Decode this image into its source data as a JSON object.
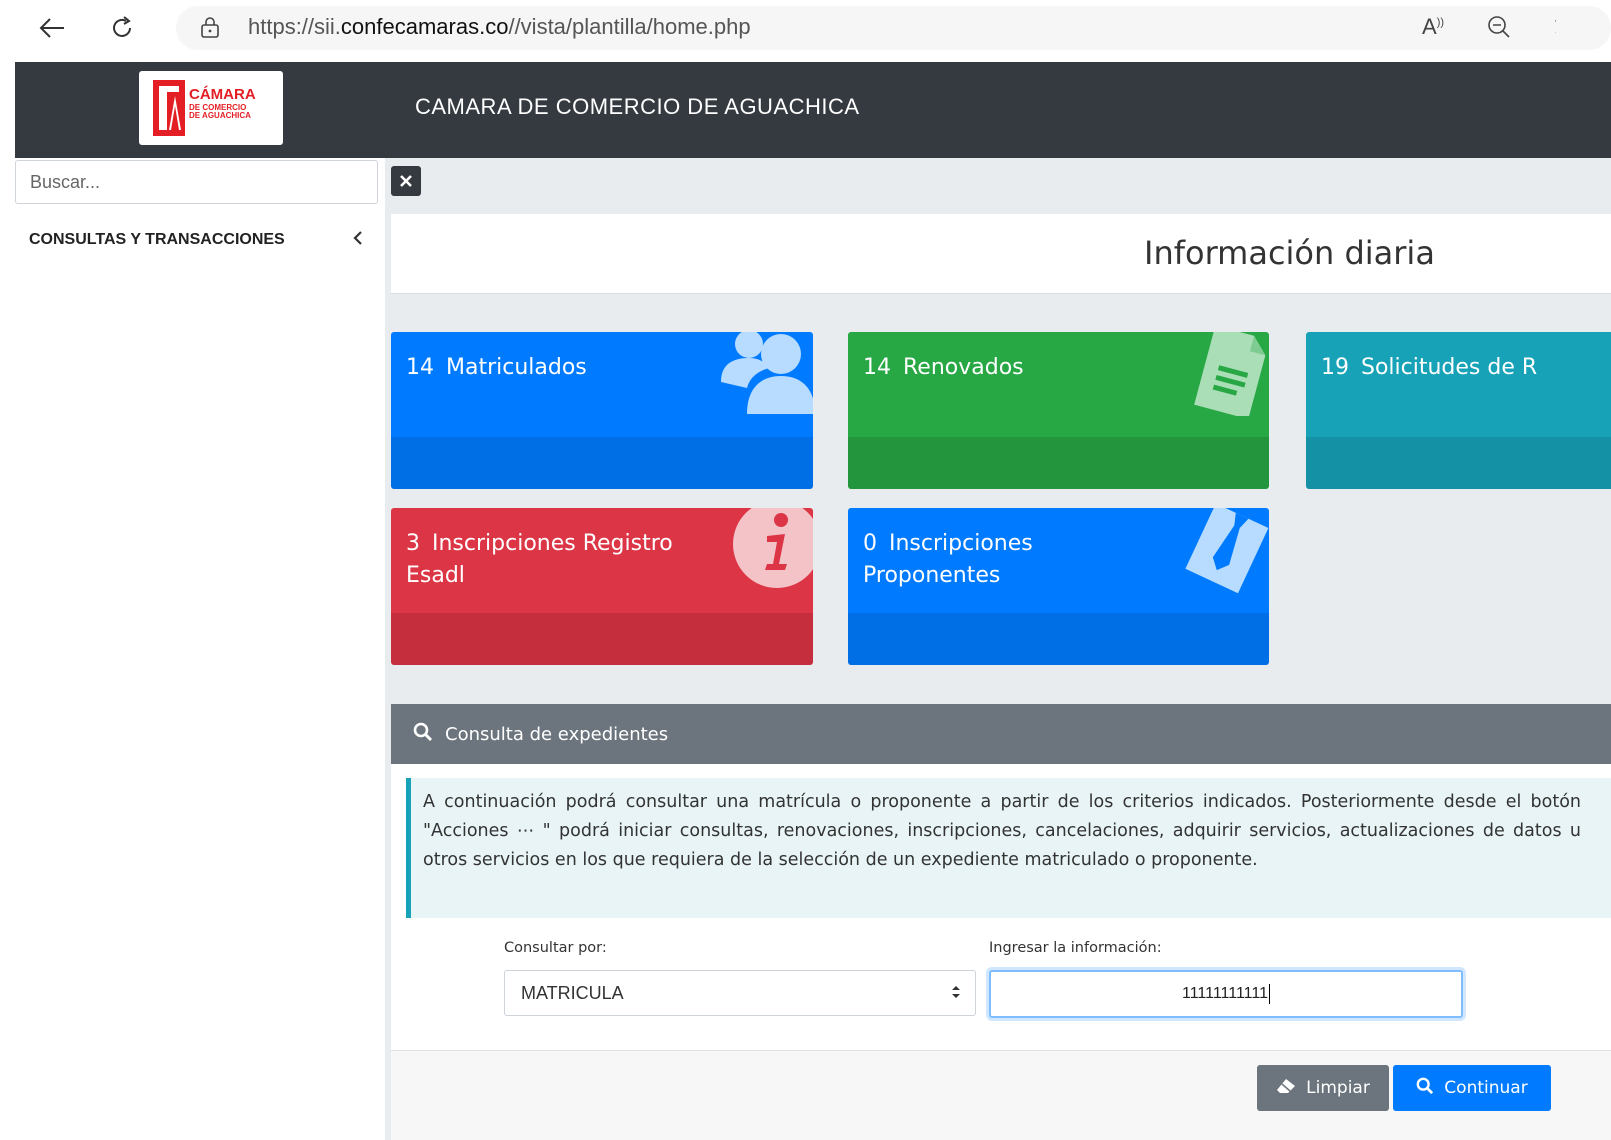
{
  "browser": {
    "url_prefix": "https://sii.",
    "url_domain": "confecamaras.co",
    "url_path": "//vista/plantilla/home.php"
  },
  "header": {
    "logo_line1": "CÁMARA",
    "logo_line2": "DE COMERCIO",
    "logo_line3": "DE AGUACHICA",
    "title": "CAMARA DE COMERCIO DE AGUACHICA"
  },
  "sidebar": {
    "search_placeholder": "Buscar...",
    "items": [
      {
        "label": "CONSULTAS Y TRANSACCIONES"
      }
    ]
  },
  "page": {
    "title": "Información diaria"
  },
  "cards": [
    {
      "count": "14",
      "label": "Matriculados",
      "color": "#007bff",
      "icon": "users-icon"
    },
    {
      "count": "14",
      "label": "Renovados",
      "color": "#28a745",
      "icon": "document-icon"
    },
    {
      "count": "19",
      "label": "Solicitudes de R",
      "color": "#17a2b8",
      "icon": ""
    },
    {
      "count": "3",
      "label_line1": "Inscripciones Registro",
      "label_line2": "Esadl",
      "color": "#dc3545",
      "icon": "info-icon"
    },
    {
      "count": "0",
      "label_line1": "Inscripciones",
      "label_line2": "Proponentes",
      "color": "#007bff",
      "icon": "tie-icon"
    }
  ],
  "consulta": {
    "panel_title": "Consulta de expedientes",
    "info_text": "A continuación podrá consultar una matrícula o proponente a partir de los criterios indicados. Posteriormente desde el botón \"Acciones ⋯ \" podrá iniciar consultas, renovaciones, inscripciones, cancelaciones, adquirir servicios, actualizaciones de datos u otros servicios en los que requiera de la selección de un expediente matriculado o proponente.",
    "consultar_por_label": "Consultar por:",
    "consultar_por_value": "MATRICULA",
    "ingresar_label": "Ingresar la información:",
    "ingresar_value": "11111111111",
    "clear_label": "Limpiar",
    "continue_label": "Continuar"
  }
}
